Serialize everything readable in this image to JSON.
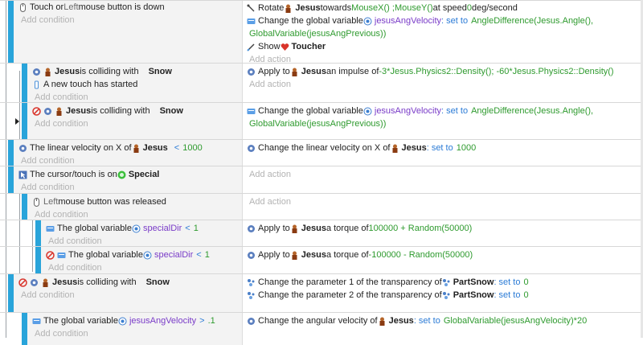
{
  "common": {
    "add_condition": "Add condition",
    "add_action": "Add action"
  },
  "events": [
    {
      "conditions": [
        {
          "pre": "Touch or ",
          "gray": "Left",
          "post": " mouse button is down"
        }
      ],
      "actions": [
        {
          "text_a": "Rotate ",
          "obj": "Jesus",
          "text_b": " towards ",
          "value": "MouseX() ;MouseY()",
          "text_c": " at speed ",
          "value2": "0",
          "text_d": "deg/second"
        },
        {
          "text_a": "Change the global variable ",
          "var": "jesusAngVelocity",
          "op": ": set to ",
          "value": "AngleDifference(Jesus.Angle(),",
          "value_line2": "GlobalVariable(jesusAngPrevious))"
        },
        {
          "text_a": "Show ",
          "obj": "Toucher"
        }
      ]
    },
    {
      "conditions": [
        {
          "obj": "Jesus",
          "mid": " is colliding with ",
          "obj2": "Snow"
        },
        {
          "text": "A new touch has started"
        }
      ],
      "actions": [
        {
          "text_a": "Apply to ",
          "obj": "Jesus",
          "text_b": " an impulse of ",
          "value": "-3*Jesus.Physics2::Density(); -60*Jesus.Physics2::Density()"
        }
      ]
    },
    {
      "conditions": [
        {
          "obj": "Jesus",
          "mid": " is colliding with ",
          "obj2": "Snow"
        }
      ],
      "actions": [
        {
          "text_a": "Change the global variable ",
          "var": "jesusAngVelocity",
          "op": ": set to ",
          "value": "AngleDifference(Jesus.Angle(),",
          "value_line2": "GlobalVariable(jesusAngPrevious))"
        }
      ]
    },
    {
      "conditions": [
        {
          "pre": "The linear velocity on X of ",
          "obj": "Jesus",
          "cmp": "<",
          "value": "1000"
        }
      ],
      "actions": [
        {
          "text_a": "Change the linear velocity on X of ",
          "obj": "Jesus",
          "op": ": set to ",
          "value": "1000"
        }
      ]
    },
    {
      "conditions": [
        {
          "pre": "The cursor/touch is on ",
          "obj": "Special"
        }
      ],
      "actions": []
    },
    {
      "conditions": [
        {
          "gray": "Left",
          "post": " mouse button was released"
        }
      ],
      "actions": []
    },
    {
      "conditions": [
        {
          "pre": "The global variable ",
          "var": "specialDir",
          "cmp": "<",
          "value": "1"
        }
      ],
      "actions": [
        {
          "text_a": "Apply to ",
          "obj": "Jesus",
          "text_b": " a torque of ",
          "value": "100000 + Random(50000)"
        }
      ]
    },
    {
      "conditions": [
        {
          "pre": "The global variable ",
          "var": "specialDir",
          "cmp": "<",
          "value": "1"
        }
      ],
      "actions": [
        {
          "text_a": "Apply to ",
          "obj": "Jesus",
          "text_b": " a torque of ",
          "value": "-100000 - Random(50000)"
        }
      ]
    },
    {
      "conditions": [
        {
          "obj": "Jesus",
          "mid": " is colliding with ",
          "obj2": "Snow"
        }
      ],
      "actions": [
        {
          "text_a": "Change the parameter 1 of the transparency of ",
          "obj": "PartSnow",
          "op": ": set to ",
          "value": "0"
        },
        {
          "text_a": "Change the parameter 2 of the transparency of ",
          "obj": "PartSnow",
          "op": ": set to ",
          "value": "0"
        }
      ]
    },
    {
      "conditions": [
        {
          "pre": "The global variable ",
          "var": "jesusAngVelocity",
          "cmp": ">",
          "value": ".1"
        }
      ],
      "actions": [
        {
          "text_a": "Change the angular velocity of ",
          "obj": "Jesus",
          "op": ": set to ",
          "value": "GlobalVariable(jesusAngVelocity)*20"
        }
      ]
    }
  ]
}
